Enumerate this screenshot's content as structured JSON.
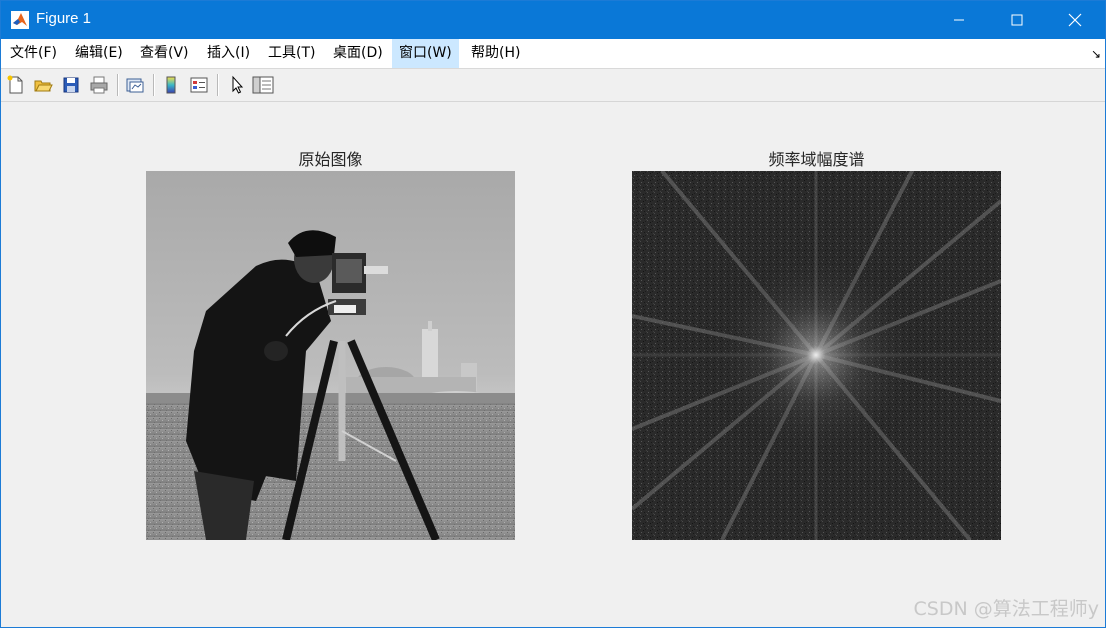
{
  "window": {
    "title": "Figure 1",
    "controls": [
      "minimize",
      "maximize",
      "close"
    ]
  },
  "menubar": {
    "items": [
      {
        "label": "文件(F)"
      },
      {
        "label": "编辑(E)"
      },
      {
        "label": "查看(V)"
      },
      {
        "label": "插入(I)"
      },
      {
        "label": "工具(T)"
      },
      {
        "label": "桌面(D)"
      },
      {
        "label": "窗口(W)",
        "active": true
      },
      {
        "label": "帮助(H)"
      }
    ],
    "corner_glyph": "↘"
  },
  "toolbar": {
    "icons": [
      "new-figure-icon",
      "open-file-icon",
      "save-icon",
      "print-icon",
      "link-plot-icon",
      "colorbar-icon",
      "legend-icon",
      "edit-plot-arrow-icon",
      "property-inspector-icon"
    ]
  },
  "axes": [
    {
      "title": "原始图像",
      "content": "cameraman grayscale photo"
    },
    {
      "title": "频率域幅度谱",
      "content": "fft magnitude spectrum"
    }
  ],
  "watermark": "CSDN @算法工程师y"
}
